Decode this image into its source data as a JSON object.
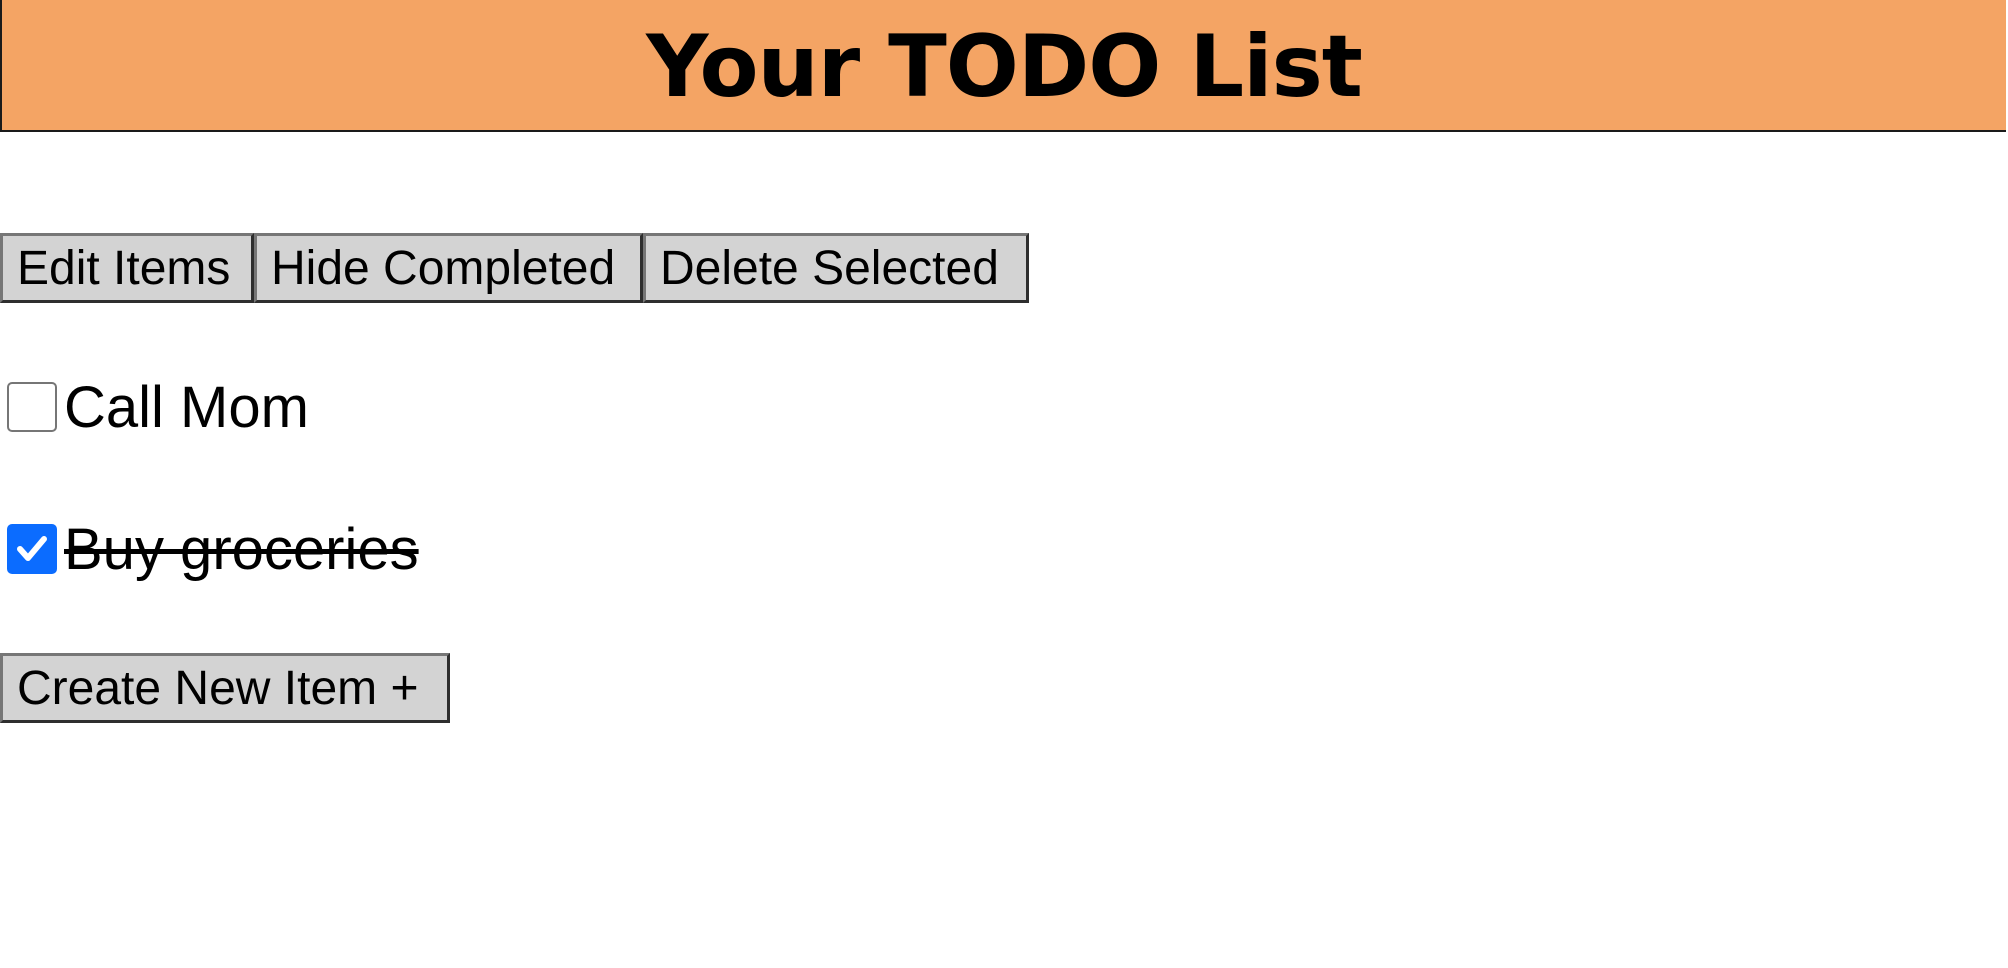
{
  "header": {
    "title": "Your TODO List",
    "background": "#f4a464"
  },
  "toolbar": {
    "edit_label": "Edit Items",
    "hide_label": "Hide Completed",
    "delete_label": "Delete Selected"
  },
  "todos": [
    {
      "label": "Call Mom",
      "checked": false
    },
    {
      "label": "Buy groceries",
      "checked": true
    }
  ],
  "create": {
    "label": "Create New Item +"
  },
  "colors": {
    "checkbox_checked": "#0b6cff",
    "button_bg": "#d3d3d3"
  },
  "icons": {
    "checkmark": "checkmark-icon"
  }
}
